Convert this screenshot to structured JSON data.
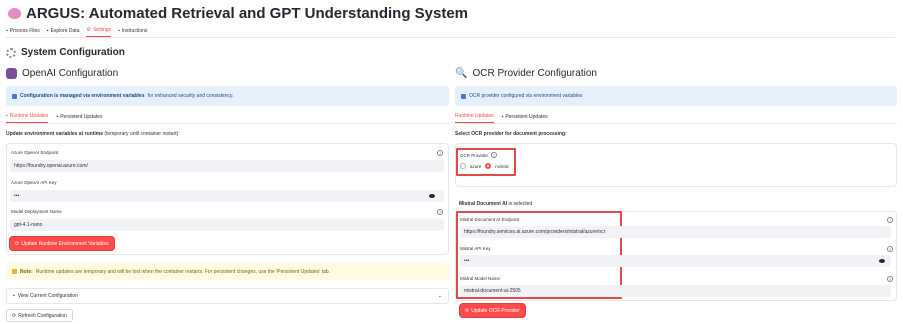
{
  "app": {
    "title": "ARGUS: Automated Retrieval and GPT Understanding System"
  },
  "tabs": [
    {
      "label": "Process Files"
    },
    {
      "label": "Explore Data"
    },
    {
      "label": "Settings"
    },
    {
      "label": "Instructions"
    }
  ],
  "active_tab": "Settings",
  "system": {
    "heading": "System Configuration"
  },
  "openai": {
    "heading": "OpenAI Configuration",
    "info_bold": "Configuration is managed via environment variables",
    "info_rest": "for enhanced security and consistency.",
    "subtabs": [
      "Runtime Updates",
      "Persistent Updates"
    ],
    "update_bold": "Update environment variables at runtime",
    "update_rest": "(temporary until container restart):",
    "endpoint_label": "Azure OpenAI Endpoint",
    "endpoint_value": "https://foundry.openai.azure.com/",
    "apikey_label": "Azure OpenAI API Key",
    "apikey_value": "•••",
    "model_label": "Model Deployment Name",
    "model_value": "gpt-4.1-nano",
    "update_button": "Update Runtime Environment Variables",
    "note_bold": "Note:",
    "note_text": "Runtime updates are temporary and will be lost when the container restarts. For persistent changes, use the 'Persistent Updates' tab.",
    "expander_label": "View Current Configuration",
    "refresh_button": "Refresh Configuration"
  },
  "ocr": {
    "heading": "OCR Provider Configuration",
    "info_text": "OCR provider configured via environment variables",
    "subtabs": [
      "Runtime Updates",
      "Persistent Updates"
    ],
    "select_label": "Select OCR provider for document processing:",
    "provider_label": "OCR Provider",
    "options": [
      "azure",
      "mistral"
    ],
    "selected_option": "mistral",
    "selected_bold": "Mistral Document AI",
    "selected_rest": "is selected",
    "endpoint_label": "Mistral Document AI Endpoint",
    "endpoint_value": "https://foundry.services.ai.azure.com/providers/mistral/azure/ocr",
    "apikey_label": "Mistral API Key",
    "apikey_value": "•••",
    "model_label": "Mistral Model Name",
    "model_value": "mistral-document-ai-2505",
    "update_button": "Update OCR Provider"
  },
  "colors": {
    "accent": "#ff4b4b",
    "info_bg": "#e6f0fb",
    "warn_bg": "#fffbe0",
    "highlight_box": "#e04a4a"
  }
}
